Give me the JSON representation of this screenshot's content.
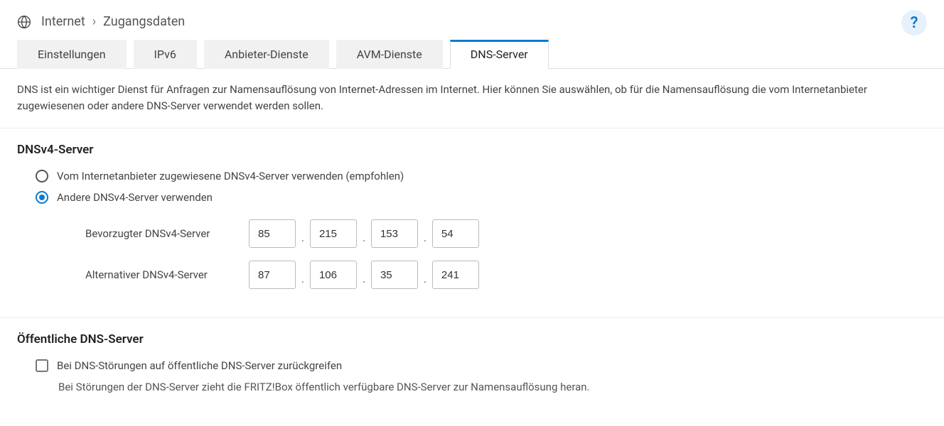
{
  "breadcrumb": {
    "item1": "Internet",
    "item2": "Zugangsdaten"
  },
  "help_label": "?",
  "tabs": [
    {
      "label": "Einstellungen"
    },
    {
      "label": "IPv6"
    },
    {
      "label": "Anbieter-Dienste"
    },
    {
      "label": "AVM-Dienste"
    },
    {
      "label": "DNS-Server"
    }
  ],
  "intro_text": "DNS ist ein wichtiger Dienst für Anfragen zur Namensauflösung von Internet-Adressen im Internet. Hier können Sie auswählen, ob für die Namensauflösung die vom Internetanbieter zugewiesenen oder andere DNS-Server verwendet werden sollen.",
  "dnsv4": {
    "heading": "DNSv4-Server",
    "radio_provider": "Vom Internetanbieter zugewiesene DNSv4-Server verwenden (empfohlen)",
    "radio_other": "Andere DNSv4-Server verwenden",
    "preferred_label": "Bevorzugter DNSv4-Server",
    "alternative_label": "Alternativer DNSv4-Server",
    "preferred_ip": [
      "85",
      "215",
      "153",
      "54"
    ],
    "alternative_ip": [
      "87",
      "106",
      "35",
      "241"
    ]
  },
  "public_dns": {
    "heading": "Öffentliche DNS-Server",
    "checkbox_label": "Bei DNS-Störungen auf öffentliche DNS-Server zurückgreifen",
    "note": "Bei Störungen der DNS-Server zieht die FRITZ!Box öffentlich verfügbare DNS-Server zur Namensauflösung heran."
  }
}
